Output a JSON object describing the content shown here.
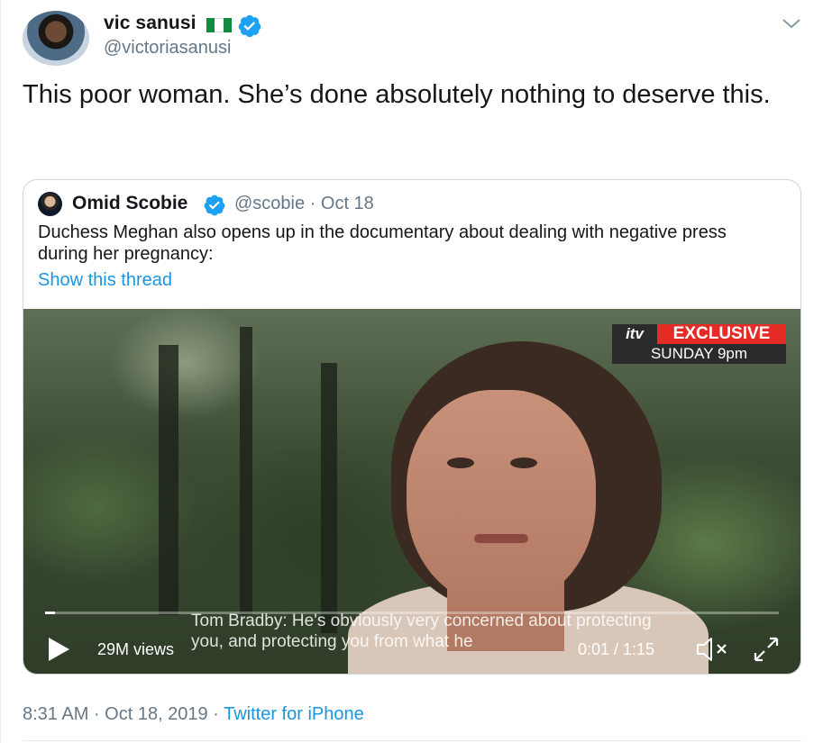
{
  "author": {
    "name": "vic sanusi",
    "flag_icon": "nigeria-flag-icon",
    "verified_icon": "verified-badge-icon",
    "handle": "@victoriasanusi"
  },
  "menu_icon": "chevron-down-icon",
  "tweet": {
    "text": "This poor woman. She’s done absolutely nothing to deserve this."
  },
  "quoted_tweet": {
    "name": "Omid Scobie",
    "verified_icon": "verified-badge-icon",
    "meta": "@scobie · Oct 18",
    "text": "Duchess Meghan also opens up in the documentary about dealing with negative press during her pregnancy:",
    "thread_link": "Show this thread",
    "video": {
      "overlay_logo": "itv",
      "overlay_badge": "EXCLUSIVE",
      "overlay_schedule": "SUNDAY 9pm",
      "subtitle": "Tom Bradby: He's obviously very concerned about protecting you, and protecting you from what he",
      "views": "29M views",
      "time": "0:01 / 1:15",
      "progress_fraction": 0.013,
      "play_icon": "play-icon",
      "mute_icon": "volume-muted-icon",
      "fullscreen_icon": "fullscreen-icon"
    }
  },
  "footer": {
    "timestamp": "8:31 AM · Oct 18, 2019 · ",
    "source": "Twitter for iPhone"
  },
  "colors": {
    "link": "#1b95e0",
    "secondary_text": "#657786",
    "border": "#ccd6dd",
    "verified": "#1da1f2",
    "itv_red": "#e42b25"
  }
}
